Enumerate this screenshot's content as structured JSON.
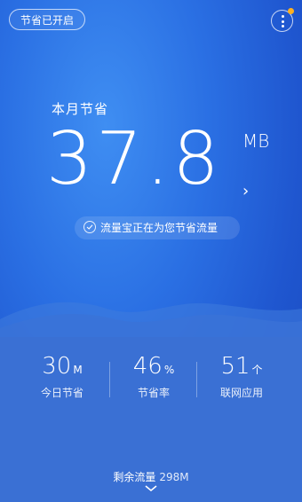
{
  "header": {
    "save_status": "节省已开启",
    "menu_icon": "more-vertical-icon",
    "notify_color": "#ffb020"
  },
  "summary": {
    "label": "本月节省",
    "value": "37.8",
    "unit": "MB"
  },
  "status_text": "流量宝正在为您节省流量",
  "stats": [
    {
      "value": "30",
      "unit": "M",
      "label": "今日节省"
    },
    {
      "value": "46",
      "unit": "%",
      "label": "节省率"
    },
    {
      "value": "51",
      "unit": "个",
      "label": "联网应用"
    }
  ],
  "remaining": {
    "label": "剩余流量",
    "value": "298M"
  },
  "colors": {
    "bg_top": "#3f8ef2",
    "bg_bottom": "#1a49bd",
    "wave": "#3b73d7"
  }
}
